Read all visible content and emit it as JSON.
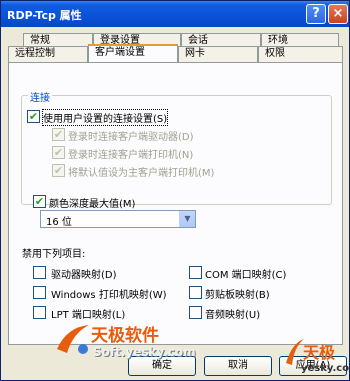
{
  "window": {
    "title": "RDP-Tcp 属性"
  },
  "title_buttons": {
    "help": "?",
    "close": "×"
  },
  "tabs_back": [
    "常规",
    "登录设置",
    "会话",
    "环境"
  ],
  "tabs_front": [
    "远程控制",
    "客户端设置",
    "网卡",
    "权限"
  ],
  "active_tab": "客户端设置",
  "connection": {
    "legend": "连接",
    "use_user_settings": "使用用户设置的连接设置(S)",
    "drives": "登录时连接客户端驱动器(D)",
    "printers": "登录时连接客户端打印机(N)",
    "default_printer": "将默认值设为主客户端打印机(M)"
  },
  "color": {
    "label": "颜色深度最大值(M)",
    "value": "16 位"
  },
  "disable": {
    "label": "禁用下列项目:",
    "items": [
      "驱动器映射(D)",
      "Windows 打印机映射(W)",
      "LPT 端口映射(L)",
      "COM 端口映射(C)",
      "剪贴板映射(B)",
      "音频映射(U)"
    ]
  },
  "buttons": {
    "ok": "确定",
    "cancel": "取消",
    "apply": "应用(A)"
  },
  "watermark": {
    "brand": "天极软件",
    "site": "Soft.yesky.com",
    "corner_brand": "天极",
    "corner_site": "yesky.com"
  },
  "colors": {
    "title_bar": "#0a52d8",
    "legend": "#0046d5",
    "watermark": "#e85c0d"
  }
}
